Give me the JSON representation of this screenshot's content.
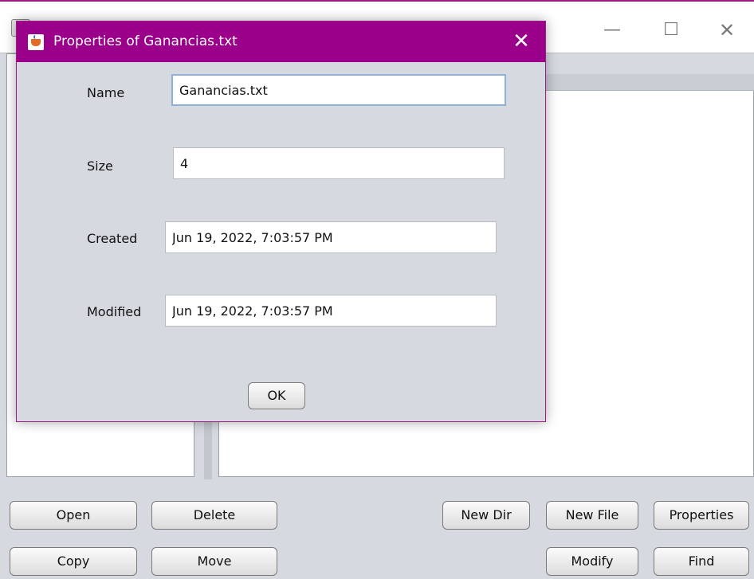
{
  "main_window": {
    "controls": {
      "minimize": "—",
      "maximize": "☐",
      "close": "✕"
    },
    "buttons": {
      "open": "Open",
      "delete": "Delete",
      "new_dir": "New Dir",
      "new_file": "New File",
      "properties": "Properties",
      "copy": "Copy",
      "move": "Move",
      "modify": "Modify",
      "find": "Find"
    }
  },
  "dialog": {
    "title": "Properties of Ganancias.txt",
    "close_glyph": "✕",
    "fields": {
      "name_label": "Name",
      "name_value": "Ganancias.txt",
      "size_label": "Size",
      "size_value": "4",
      "created_label": "Created",
      "created_value": "Jun 19, 2022, 7:03:57 PM",
      "modified_label": "Modified",
      "modified_value": "Jun 19, 2022, 7:03:57 PM"
    },
    "ok_label": "OK"
  },
  "icons": {
    "dialog_icon": "java-coffee-cup-icon",
    "main_icon": "app-window-icon"
  }
}
